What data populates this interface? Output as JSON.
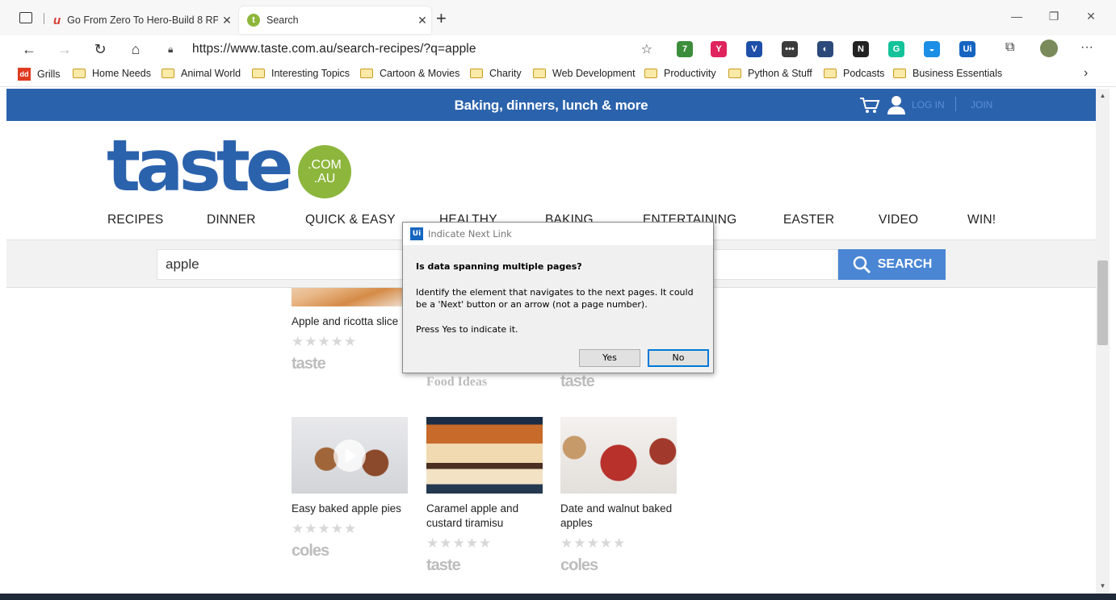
{
  "browser": {
    "tabs": [
      {
        "title": "Go From Zero To Hero-Build 8 RPA",
        "close": "✕"
      },
      {
        "title": "Search",
        "close": "✕"
      }
    ],
    "new_tab": "+",
    "url": "https://www.taste.com.au/search-recipes/?q=apple",
    "extensions": [
      {
        "label": "7",
        "color": "#3c8d3c"
      },
      {
        "label": "Y",
        "color": "#e0245e"
      },
      {
        "label": "V",
        "color": "#1e4fa8"
      },
      {
        "label": "•••",
        "color": "#3b3b3b"
      },
      {
        "label": "◐",
        "color": "#2b4a7a"
      },
      {
        "label": "N",
        "color": "#222222"
      },
      {
        "label": "G",
        "color": "#15c39a"
      },
      {
        "label": "◒",
        "color": "#1b8fe6"
      },
      {
        "label": "Ui",
        "color": "#1565c0"
      }
    ],
    "bookmarks": [
      "Grills",
      "Home Needs",
      "Animal World",
      "Interesting Topics",
      "Cartoon & Movies",
      "Charity",
      "Web Development",
      "Productivity",
      "Python & Stuff",
      "Podcasts",
      "Business Essentials"
    ],
    "bookmark_first_icon": "dd"
  },
  "site": {
    "tagline": "Baking, dinners, lunch & more",
    "login": "LOG IN",
    "join": "JOIN",
    "logo_word": "taste",
    "logo_badge_top": ".COM",
    "logo_badge_bottom": ".AU",
    "nav": [
      "RECIPES",
      "DINNER",
      "QUICK & EASY",
      "HEALTHY",
      "BAKING",
      "ENTERTAINING",
      "EASTER",
      "VIDEO",
      "WIN!"
    ],
    "search_value": "apple",
    "search_button": "SEARCH",
    "stars": "★★★★★",
    "cards_row1": [
      {
        "title": "Apple and ricotta slice",
        "brand": "taste"
      }
    ],
    "row1_brands_partial": [
      "Food Ideas",
      "taste"
    ],
    "cards_row2": [
      {
        "title": "Easy baked apple pies",
        "brand": "coles"
      },
      {
        "title": "Caramel apple and custard tiramisu",
        "brand": "taste"
      },
      {
        "title": "Date and walnut baked apples",
        "brand": "coles"
      }
    ]
  },
  "dialog": {
    "app_icon": "Ui",
    "title": "Indicate Next Link",
    "question": "Is data spanning multiple pages?",
    "body": "Identify the element that navigates to the next pages. It could be a 'Next' button or an arrow (not a page number).",
    "instruction": "Press Yes to indicate it.",
    "yes": "Yes",
    "no": "No"
  },
  "colors": {
    "brand_blue": "#2b62ac",
    "brand_green": "#8db63c",
    "search_button": "#4a86d4"
  }
}
